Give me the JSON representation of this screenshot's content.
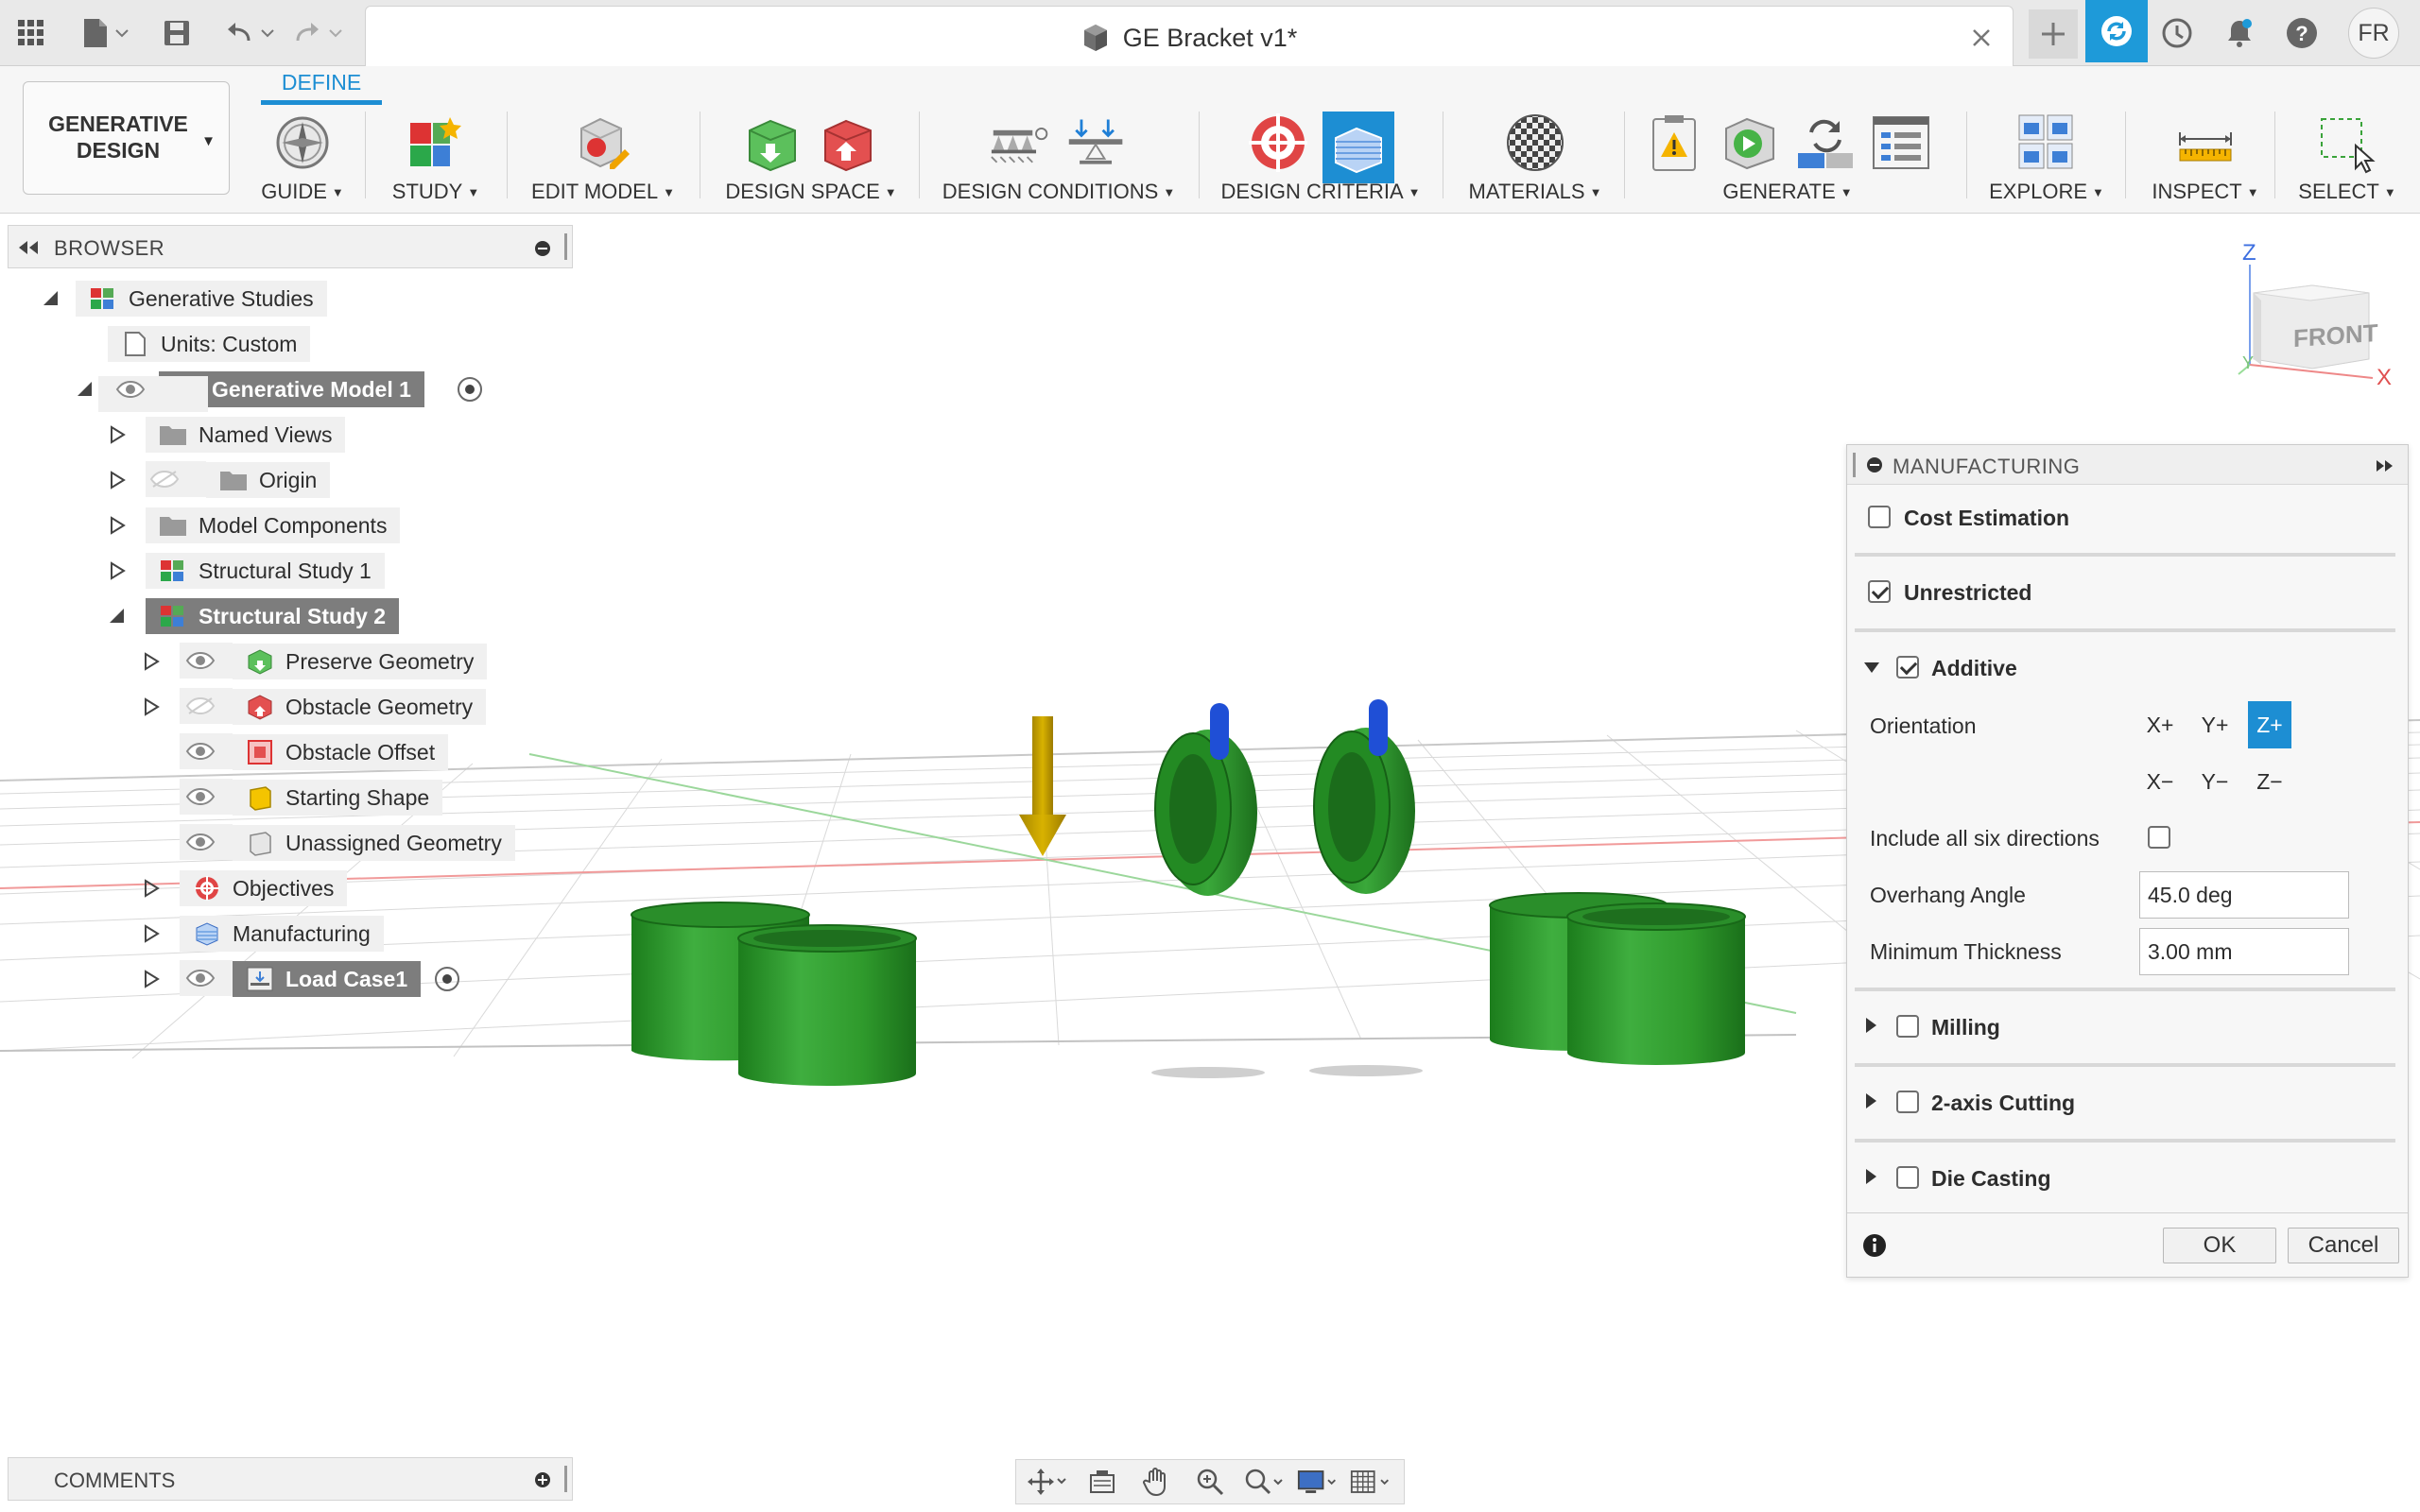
{
  "titlebar": {
    "document_title": "GE Bracket v1*",
    "user_initials": "FR"
  },
  "ribbon": {
    "active_tab": "DEFINE",
    "workspace": "GENERATIVE\nDESIGN",
    "groups": {
      "guide": "GUIDE",
      "study": "STUDY",
      "edit_model": "EDIT MODEL",
      "design_space": "DESIGN SPACE",
      "design_conditions": "DESIGN CONDITIONS",
      "design_criteria": "DESIGN CRITERIA",
      "materials": "MATERIALS",
      "generate": "GENERATE",
      "explore": "EXPLORE",
      "inspect": "INSPECT",
      "select": "SELECT"
    }
  },
  "browser": {
    "title": "BROWSER",
    "items": {
      "generative_studies": "Generative Studies",
      "units": "Units: Custom",
      "generative_model": "Generative Model 1",
      "named_views": "Named Views",
      "origin": "Origin",
      "model_components": "Model Components",
      "structural_study_1": "Structural Study 1",
      "structural_study_2": "Structural Study 2",
      "preserve_geometry": "Preserve Geometry",
      "obstacle_geometry": "Obstacle Geometry",
      "obstacle_offset": "Obstacle Offset",
      "starting_shape": "Starting Shape",
      "unassigned_geometry": "Unassigned Geometry",
      "objectives": "Objectives",
      "manufacturing": "Manufacturing",
      "load_case": "Load Case1"
    }
  },
  "manufacturing_panel": {
    "title": "MANUFACTURING",
    "cost_estimation": {
      "label": "Cost Estimation",
      "checked": false
    },
    "unrestricted": {
      "label": "Unrestricted",
      "checked": true
    },
    "additive": {
      "label": "Additive",
      "checked": true,
      "orientation_label": "Orientation",
      "orientations": [
        "X+",
        "Y+",
        "Z+",
        "X−",
        "Y−",
        "Z−"
      ],
      "selected_orientation": "Z+",
      "include_all_label": "Include all six directions",
      "include_all_checked": false,
      "overhang_label": "Overhang Angle",
      "overhang_value": "45.0 deg",
      "min_thickness_label": "Minimum Thickness",
      "min_thickness_value": "3.00 mm"
    },
    "milling": {
      "label": "Milling",
      "checked": false
    },
    "two_axis": {
      "label": "2-axis Cutting",
      "checked": false
    },
    "die_casting": {
      "label": "Die Casting",
      "checked": false
    },
    "ok_label": "OK",
    "cancel_label": "Cancel"
  },
  "viewcube": {
    "face_label": "FRONT",
    "axis_z": "Z",
    "axis_x": "X",
    "axis_y": "Y"
  },
  "comments": {
    "title": "COMMENTS"
  },
  "colors": {
    "accent": "#1d8ed3",
    "preserve_green": "#2f9a2c",
    "load_arrow": "#c9a300",
    "obstacle_blue": "#1f4fd6"
  }
}
